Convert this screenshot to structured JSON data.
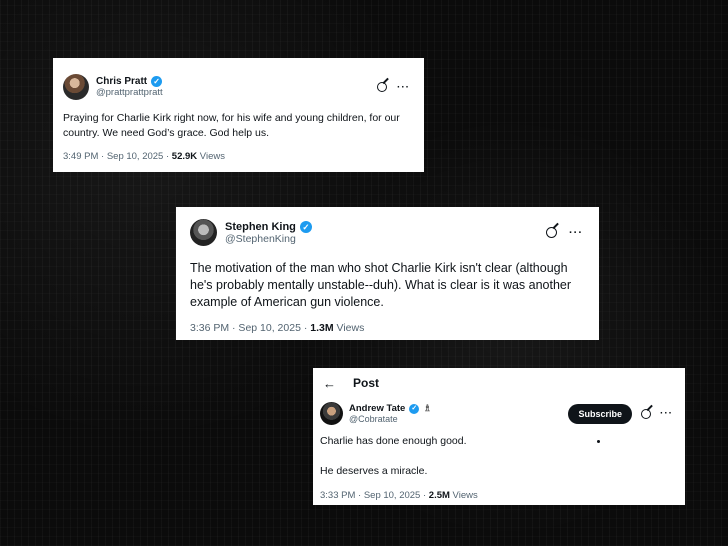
{
  "tweets": [
    {
      "name": "Chris Pratt",
      "handle": "@prattprattpratt",
      "text": "Praying for Charlie Kirk right now, for his wife and young children, for our country. We need God’s grace. God help us.",
      "time": "3:49 PM · Sep 10, 2025 · ",
      "views": "52.9K",
      "views_label": " Views"
    },
    {
      "name": "Stephen King",
      "handle": "@StephenKing",
      "text": "The motivation of the man who shot Charlie Kirk isn't clear (although he's probably mentally unstable--duh). What is clear is it was another example of American gun violence.",
      "time": "3:36 PM · Sep 10, 2025 · ",
      "views": "1.3M",
      "views_label": " Views"
    },
    {
      "header_title": "Post",
      "name": "Andrew Tate",
      "handle": "@Cobratate",
      "subscribe": "Subscribe",
      "text": "Charlie has done enough good.\n\nHe deserves a miracle.",
      "time": "3:33 PM · Sep 10, 2025 · ",
      "views": "2.5M",
      "views_label": " Views"
    }
  ],
  "icons": {
    "verified": "✓",
    "back": "←",
    "more": "···",
    "affiliate": "♗"
  }
}
